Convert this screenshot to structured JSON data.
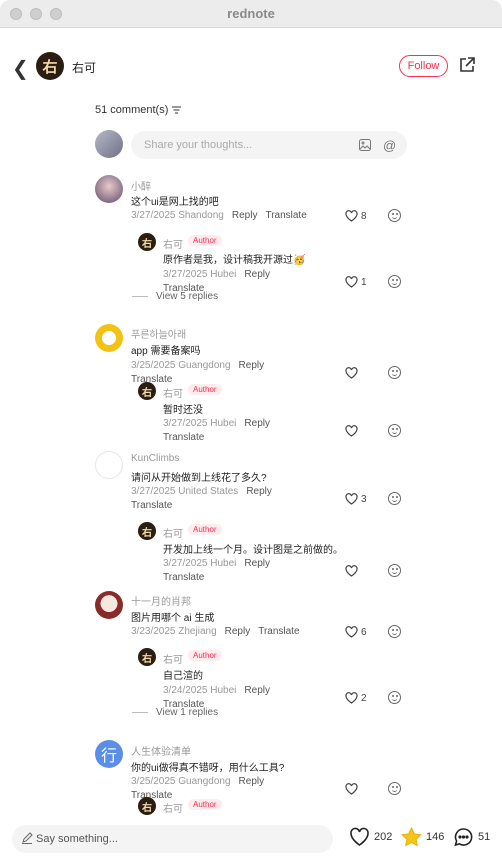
{
  "window": {
    "title": "rednote"
  },
  "header": {
    "author_name": "右可",
    "avatar_char": "右",
    "follow_label": "Follow"
  },
  "comments_header": {
    "count_label": "51 comment(s)"
  },
  "composer": {
    "placeholder": "Share your thoughts..."
  },
  "comments": [
    {
      "user": "小醉",
      "text": "这个ui是网上找的吧",
      "date_loc": "3/27/2025 Shandong",
      "reply": "Reply",
      "translate": "Translate",
      "likes": "8",
      "reply_item": {
        "user": "右可",
        "badge": "Author",
        "text": "原作者是我，设计稿我开源过🥳",
        "date_loc": "3/27/2025 Hubei",
        "reply": "Reply",
        "translate": "Translate",
        "likes": "1"
      },
      "view_replies": "View 5 replies"
    },
    {
      "user": "푸른하늘아래",
      "text": "app 需要备案吗",
      "date_loc": "3/25/2025 Guangdong",
      "reply": "Reply",
      "translate": "Translate",
      "likes": "",
      "reply_item": {
        "user": "右可",
        "badge": "Author",
        "text": "暂时还没",
        "date_loc": "3/27/2025 Hubei",
        "reply": "Reply",
        "translate": "Translate",
        "likes": ""
      }
    },
    {
      "user": "KunClimbs",
      "text": "请问从开始做到上线花了多久?",
      "date_loc": "3/27/2025 United States",
      "reply": "Reply",
      "translate": "Translate",
      "likes": "3",
      "reply_item": {
        "user": "右可",
        "badge": "Author",
        "text": "开发加上线一个月。设计图是之前做的。",
        "date_loc": "3/27/2025 Hubei",
        "reply": "Reply",
        "translate": "Translate",
        "likes": ""
      }
    },
    {
      "user": "十一月的肖邦",
      "text": "图片用哪个 ai 生成",
      "date_loc": "3/23/2025 Zhejiang",
      "reply": "Reply",
      "translate": "Translate",
      "likes": "6",
      "reply_item": {
        "user": "右可",
        "badge": "Author",
        "text": "自己渲的",
        "date_loc": "3/24/2025 Hubei",
        "reply": "Reply",
        "translate": "Translate",
        "likes": "2"
      },
      "view_replies": "View 1 replies"
    },
    {
      "user": "人生体验清单",
      "text": "你的ui做得真不错呀，用什么工具?",
      "date_loc": "3/25/2025 Guangdong",
      "reply": "Reply",
      "translate": "Translate",
      "likes": "",
      "reply_item": {
        "user": "右可",
        "badge": "Author"
      },
      "avatar_char": "行"
    }
  ],
  "footer": {
    "placeholder": "Say something...",
    "likes": "202",
    "stars": "146",
    "comments": "51"
  }
}
